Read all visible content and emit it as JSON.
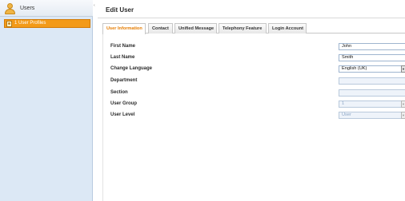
{
  "sidebar": {
    "title": "Users",
    "items": [
      {
        "label": "1 User Profiles",
        "selected": true
      }
    ]
  },
  "main": {
    "title": "Edit User",
    "tabs": [
      {
        "label": "User Information",
        "active": true
      },
      {
        "label": "Contact",
        "active": false
      },
      {
        "label": "Unified Message",
        "active": false
      },
      {
        "label": "Telephony Feature",
        "active": false
      },
      {
        "label": "Login Account",
        "active": false
      }
    ],
    "form": {
      "first_name": {
        "label": "First Name",
        "value": "John"
      },
      "last_name": {
        "label": "Last Name",
        "value": "Smith"
      },
      "change_language": {
        "label": "Change Language",
        "value": "English (UK)"
      },
      "department": {
        "label": "Department",
        "value": ""
      },
      "section": {
        "label": "Section",
        "value": ""
      },
      "user_group": {
        "label": "User Group",
        "value": "1"
      },
      "user_level": {
        "label": "User Level",
        "value": "User"
      }
    }
  },
  "colors": {
    "sidebar_bg": "#dce8f5",
    "selected_item": "#f39a18",
    "active_tab_text": "#e57c00"
  },
  "icons": {
    "sidebar_header": "users-icon",
    "sidebar_item": "user-profile-icon",
    "dropdown": "chevron-down-icon"
  }
}
